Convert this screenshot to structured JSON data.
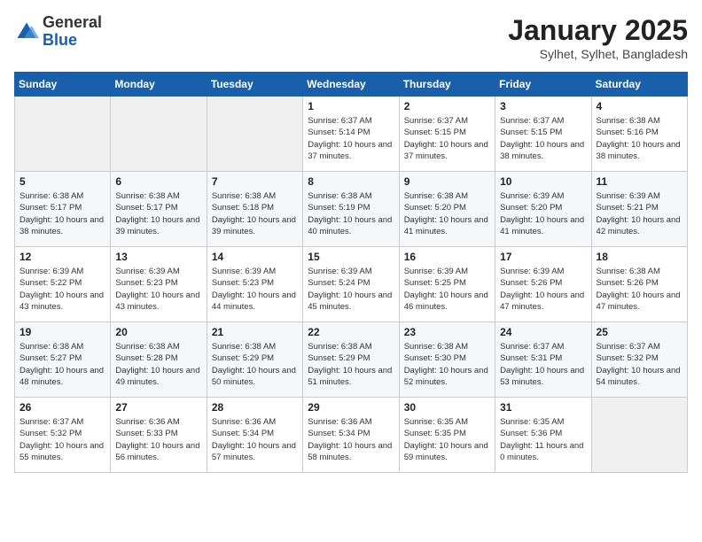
{
  "header": {
    "logo_general": "General",
    "logo_blue": "Blue",
    "month_title": "January 2025",
    "location": "Sylhet, Sylhet, Bangladesh"
  },
  "weekdays": [
    "Sunday",
    "Monday",
    "Tuesday",
    "Wednesday",
    "Thursday",
    "Friday",
    "Saturday"
  ],
  "weeks": [
    {
      "days": [
        {
          "num": "",
          "empty": true
        },
        {
          "num": "",
          "empty": true
        },
        {
          "num": "",
          "empty": true
        },
        {
          "num": "1",
          "sunrise": "6:37 AM",
          "sunset": "5:14 PM",
          "daylight": "10 hours and 37 minutes."
        },
        {
          "num": "2",
          "sunrise": "6:37 AM",
          "sunset": "5:15 PM",
          "daylight": "10 hours and 37 minutes."
        },
        {
          "num": "3",
          "sunrise": "6:37 AM",
          "sunset": "5:15 PM",
          "daylight": "10 hours and 38 minutes."
        },
        {
          "num": "4",
          "sunrise": "6:38 AM",
          "sunset": "5:16 PM",
          "daylight": "10 hours and 38 minutes."
        }
      ]
    },
    {
      "days": [
        {
          "num": "5",
          "sunrise": "6:38 AM",
          "sunset": "5:17 PM",
          "daylight": "10 hours and 38 minutes."
        },
        {
          "num": "6",
          "sunrise": "6:38 AM",
          "sunset": "5:17 PM",
          "daylight": "10 hours and 39 minutes."
        },
        {
          "num": "7",
          "sunrise": "6:38 AM",
          "sunset": "5:18 PM",
          "daylight": "10 hours and 39 minutes."
        },
        {
          "num": "8",
          "sunrise": "6:38 AM",
          "sunset": "5:19 PM",
          "daylight": "10 hours and 40 minutes."
        },
        {
          "num": "9",
          "sunrise": "6:38 AM",
          "sunset": "5:20 PM",
          "daylight": "10 hours and 41 minutes."
        },
        {
          "num": "10",
          "sunrise": "6:39 AM",
          "sunset": "5:20 PM",
          "daylight": "10 hours and 41 minutes."
        },
        {
          "num": "11",
          "sunrise": "6:39 AM",
          "sunset": "5:21 PM",
          "daylight": "10 hours and 42 minutes."
        }
      ]
    },
    {
      "days": [
        {
          "num": "12",
          "sunrise": "6:39 AM",
          "sunset": "5:22 PM",
          "daylight": "10 hours and 43 minutes."
        },
        {
          "num": "13",
          "sunrise": "6:39 AM",
          "sunset": "5:23 PM",
          "daylight": "10 hours and 43 minutes."
        },
        {
          "num": "14",
          "sunrise": "6:39 AM",
          "sunset": "5:23 PM",
          "daylight": "10 hours and 44 minutes."
        },
        {
          "num": "15",
          "sunrise": "6:39 AM",
          "sunset": "5:24 PM",
          "daylight": "10 hours and 45 minutes."
        },
        {
          "num": "16",
          "sunrise": "6:39 AM",
          "sunset": "5:25 PM",
          "daylight": "10 hours and 46 minutes."
        },
        {
          "num": "17",
          "sunrise": "6:39 AM",
          "sunset": "5:26 PM",
          "daylight": "10 hours and 47 minutes."
        },
        {
          "num": "18",
          "sunrise": "6:38 AM",
          "sunset": "5:26 PM",
          "daylight": "10 hours and 47 minutes."
        }
      ]
    },
    {
      "days": [
        {
          "num": "19",
          "sunrise": "6:38 AM",
          "sunset": "5:27 PM",
          "daylight": "10 hours and 48 minutes."
        },
        {
          "num": "20",
          "sunrise": "6:38 AM",
          "sunset": "5:28 PM",
          "daylight": "10 hours and 49 minutes."
        },
        {
          "num": "21",
          "sunrise": "6:38 AM",
          "sunset": "5:29 PM",
          "daylight": "10 hours and 50 minutes."
        },
        {
          "num": "22",
          "sunrise": "6:38 AM",
          "sunset": "5:29 PM",
          "daylight": "10 hours and 51 minutes."
        },
        {
          "num": "23",
          "sunrise": "6:38 AM",
          "sunset": "5:30 PM",
          "daylight": "10 hours and 52 minutes."
        },
        {
          "num": "24",
          "sunrise": "6:37 AM",
          "sunset": "5:31 PM",
          "daylight": "10 hours and 53 minutes."
        },
        {
          "num": "25",
          "sunrise": "6:37 AM",
          "sunset": "5:32 PM",
          "daylight": "10 hours and 54 minutes."
        }
      ]
    },
    {
      "days": [
        {
          "num": "26",
          "sunrise": "6:37 AM",
          "sunset": "5:32 PM",
          "daylight": "10 hours and 55 minutes."
        },
        {
          "num": "27",
          "sunrise": "6:36 AM",
          "sunset": "5:33 PM",
          "daylight": "10 hours and 56 minutes."
        },
        {
          "num": "28",
          "sunrise": "6:36 AM",
          "sunset": "5:34 PM",
          "daylight": "10 hours and 57 minutes."
        },
        {
          "num": "29",
          "sunrise": "6:36 AM",
          "sunset": "5:34 PM",
          "daylight": "10 hours and 58 minutes."
        },
        {
          "num": "30",
          "sunrise": "6:35 AM",
          "sunset": "5:35 PM",
          "daylight": "10 hours and 59 minutes."
        },
        {
          "num": "31",
          "sunrise": "6:35 AM",
          "sunset": "5:36 PM",
          "daylight": "11 hours and 0 minutes."
        },
        {
          "num": "",
          "empty": true
        }
      ]
    }
  ],
  "labels": {
    "sunrise": "Sunrise:",
    "sunset": "Sunset:",
    "daylight": "Daylight:"
  }
}
